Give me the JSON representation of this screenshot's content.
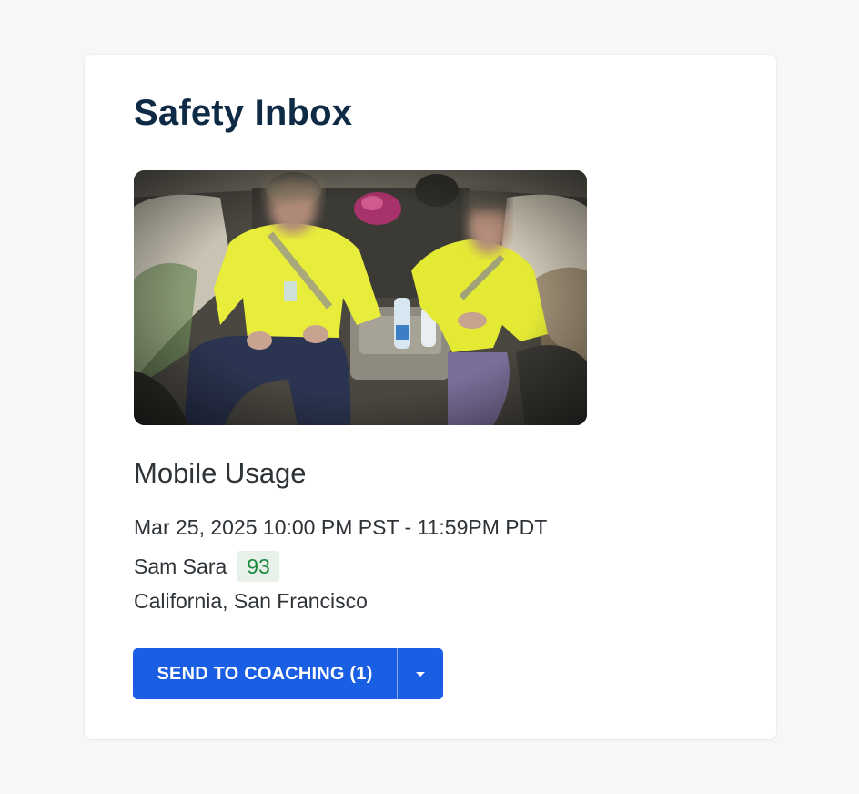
{
  "page": {
    "title": "Safety Inbox"
  },
  "event": {
    "type": "Mobile Usage",
    "time_range": "Mar 25, 2025 10:00 PM PST - 11:59PM PDT",
    "driver": "Sam Sara",
    "score": "93",
    "location": "California, San Francisco"
  },
  "actions": {
    "send_to_coaching": "SEND TO COACHING (1)",
    "dropdown_icon": "chevron-down-icon"
  },
  "colors": {
    "title": "#0e2a44",
    "primary_button": "#1a5fe3",
    "score_text": "#1a8a3d",
    "score_bg": "#e8f0ea"
  }
}
